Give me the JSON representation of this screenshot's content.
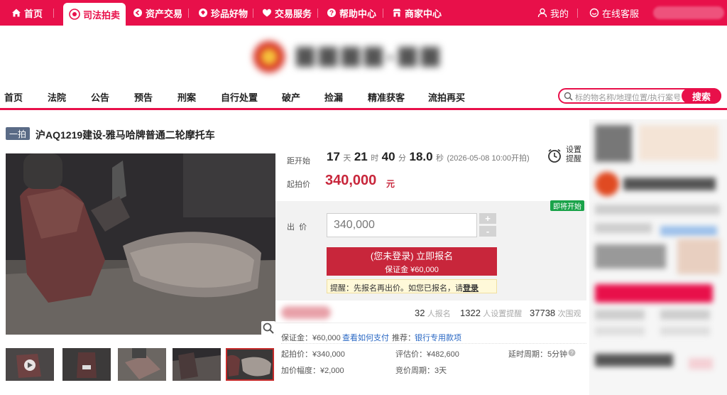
{
  "top_nav": {
    "items": [
      {
        "label": "首页",
        "icon": "home-icon"
      },
      {
        "label": "司法拍卖",
        "icon": "auction-icon",
        "active": true
      },
      {
        "label": "资产交易",
        "icon": "asset-icon"
      },
      {
        "label": "珍品好物",
        "icon": "gem-icon"
      },
      {
        "label": "交易服务",
        "icon": "heart-icon"
      },
      {
        "label": "帮助中心",
        "icon": "help-icon"
      },
      {
        "label": "商家中心",
        "icon": "shop-icon"
      }
    ],
    "my": "我的",
    "service": "在线客服"
  },
  "sec_nav": {
    "items": [
      "首页",
      "法院",
      "公告",
      "预告",
      "刑案",
      "自行处置",
      "破产",
      "捡漏",
      "精准获客",
      "流拍再买"
    ],
    "search_placeholder": "标的物名称/地理位置/执行案号",
    "search_button": "搜索"
  },
  "item": {
    "badge": "一拍",
    "title": "沪AQ1219建设-雅马哈牌普通二轮摩托车"
  },
  "countdown": {
    "label": "距开始",
    "days": "17",
    "days_unit": "天",
    "hours": "21",
    "hours_unit": "时",
    "minutes": "40",
    "minutes_unit": "分",
    "seconds": "18.0",
    "seconds_unit": "秒",
    "start_time": "(2026-05-08 10:00开拍)"
  },
  "reminder": {
    "line1": "设置",
    "line2": "提醒"
  },
  "start_price": {
    "label": "起拍价",
    "value": "340,000",
    "unit": "元"
  },
  "bid": {
    "tag": "即将开始",
    "label": "出  价",
    "value": "340,000",
    "plus": "+",
    "minus": "-",
    "signup_main": "(您未登录) 立即报名",
    "signup_deposit": "保证金 ¥60,000",
    "tip_text": "提醒：先报名再出价。如您已报名，请",
    "tip_link": "登录"
  },
  "stats": {
    "signups": "32",
    "signups_label": "人报名",
    "reminders": "1322",
    "reminders_label": "人设置提醒",
    "views": "37738",
    "views_label": "次围观"
  },
  "details": {
    "deposit": "保证金：¥60,000",
    "how_pay": "查看如何支付",
    "recommend_label": "推荐：",
    "recommend_value": "银行专用款项",
    "start_price": "起拍价：¥340,000",
    "appraisal": "评估价：¥482,600",
    "delay": "延时周期：5分钟",
    "increment": "加价幅度：¥2,000",
    "bid_cycle": "竞价周期：3天"
  },
  "colors": {
    "brand": "#e8104a",
    "price": "#c8263b",
    "tag": "#1aa34a",
    "link": "#2a68c4"
  }
}
